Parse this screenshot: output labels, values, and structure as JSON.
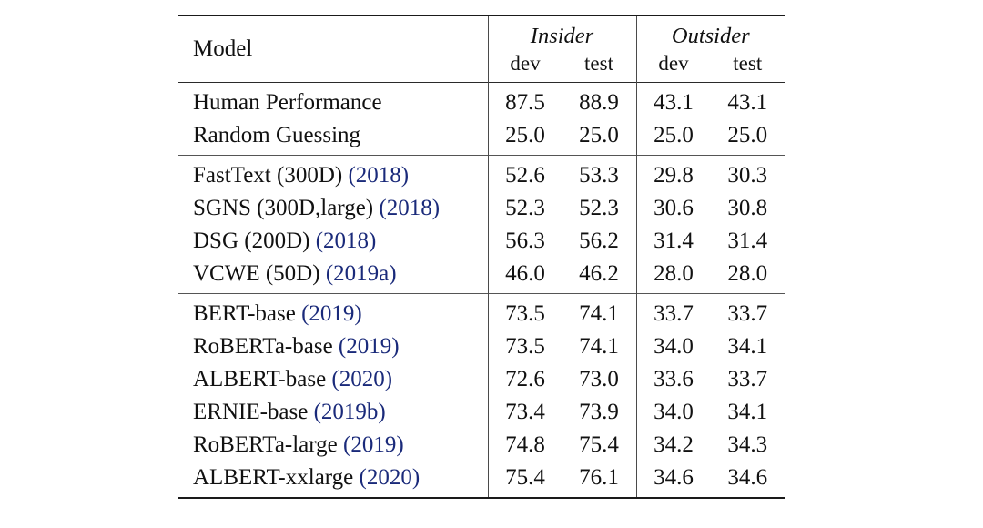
{
  "table": {
    "caption_columns": {
      "model_label": "Model",
      "groups": [
        {
          "name": "Insider",
          "sub": [
            "dev",
            "test"
          ]
        },
        {
          "name": "Outsider",
          "sub": [
            "dev",
            "test"
          ]
        }
      ]
    },
    "cite_color": "#1a2a7a",
    "blocks": [
      {
        "id": "baselines",
        "rows": [
          {
            "model": "Human Performance",
            "cite": "",
            "insider_dev": "87.5",
            "insider_test": "88.9",
            "outsider_dev": "43.1",
            "outsider_test": "43.1"
          },
          {
            "model": "Random Guessing",
            "cite": "",
            "insider_dev": "25.0",
            "insider_test": "25.0",
            "outsider_dev": "25.0",
            "outsider_test": "25.0"
          }
        ]
      },
      {
        "id": "static-embeddings",
        "rows": [
          {
            "model": "FastText (300D)",
            "cite": "(2018)",
            "insider_dev": "52.6",
            "insider_test": "53.3",
            "outsider_dev": "29.8",
            "outsider_test": "30.3"
          },
          {
            "model": "SGNS (300D,large)",
            "cite": "(2018)",
            "insider_dev": "52.3",
            "insider_test": "52.3",
            "outsider_dev": "30.6",
            "outsider_test": "30.8"
          },
          {
            "model": "DSG (200D)",
            "cite": "(2018)",
            "insider_dev": "56.3",
            "insider_test": "56.2",
            "outsider_dev": "31.4",
            "outsider_test": "31.4"
          },
          {
            "model": "VCWE (50D)",
            "cite": "(2019a)",
            "insider_dev": "46.0",
            "insider_test": "46.2",
            "outsider_dev": "28.0",
            "outsider_test": "28.0"
          }
        ]
      },
      {
        "id": "pretrained-lms",
        "rows": [
          {
            "model": "BERT-base",
            "cite": "(2019)",
            "insider_dev": "73.5",
            "insider_test": "74.1",
            "outsider_dev": "33.7",
            "outsider_test": "33.7"
          },
          {
            "model": "RoBERTa-base",
            "cite": "(2019)",
            "insider_dev": "73.5",
            "insider_test": "74.1",
            "outsider_dev": "34.0",
            "outsider_test": "34.1"
          },
          {
            "model": "ALBERT-base",
            "cite": "(2020)",
            "insider_dev": "72.6",
            "insider_test": "73.0",
            "outsider_dev": "33.6",
            "outsider_test": "33.7"
          },
          {
            "model": "ERNIE-base",
            "cite": "(2019b)",
            "insider_dev": "73.4",
            "insider_test": "73.9",
            "outsider_dev": "34.0",
            "outsider_test": "34.1"
          },
          {
            "model": "RoBERTa-large",
            "cite": "(2019)",
            "insider_dev": "74.8",
            "insider_test": "75.4",
            "outsider_dev": "34.2",
            "outsider_test": "34.3"
          },
          {
            "model": "ALBERT-xxlarge",
            "cite": "(2020)",
            "insider_dev": "75.4",
            "insider_test": "76.1",
            "outsider_dev": "34.6",
            "outsider_test": "34.6"
          }
        ]
      }
    ]
  }
}
